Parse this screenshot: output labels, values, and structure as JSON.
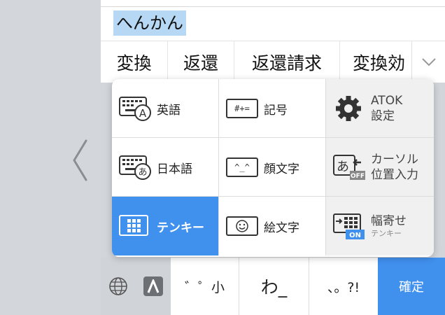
{
  "input": {
    "text": "へんかん"
  },
  "candidates": [
    "変換",
    "返還",
    "返還請求",
    "変換効"
  ],
  "popup": {
    "items": [
      {
        "label": "英語",
        "icon": "keyboard-a-icon"
      },
      {
        "label": "記号",
        "icon": "symbol-key-icon",
        "icon_text": "#+="
      },
      {
        "label1": "ATOK",
        "label2": "設定",
        "icon": "gear-icon"
      },
      {
        "label": "日本語",
        "icon": "keyboard-hiragana-icon"
      },
      {
        "label": "顔文字",
        "icon": "kaomoji-icon",
        "icon_text": "^_^"
      },
      {
        "label1": "カーソル",
        "label2": "位置入力",
        "icon": "cursor-position-icon",
        "badge": "OFF"
      },
      {
        "label": "テンキー",
        "icon": "tenkey-grid-icon",
        "selected": true
      },
      {
        "label": "絵文字",
        "icon": "smiley-icon"
      },
      {
        "label1": "幅寄せ",
        "label2": "テンキー",
        "icon": "shift-tenkey-icon",
        "badge": "ON"
      }
    ]
  },
  "bottom_keys": {
    "dakuten": "゛゜小",
    "wa": "わ_",
    "punct": "、。?!",
    "confirm": "確定"
  },
  "colors": {
    "accent": "#4090ee",
    "selection": "#b6d8f5"
  }
}
